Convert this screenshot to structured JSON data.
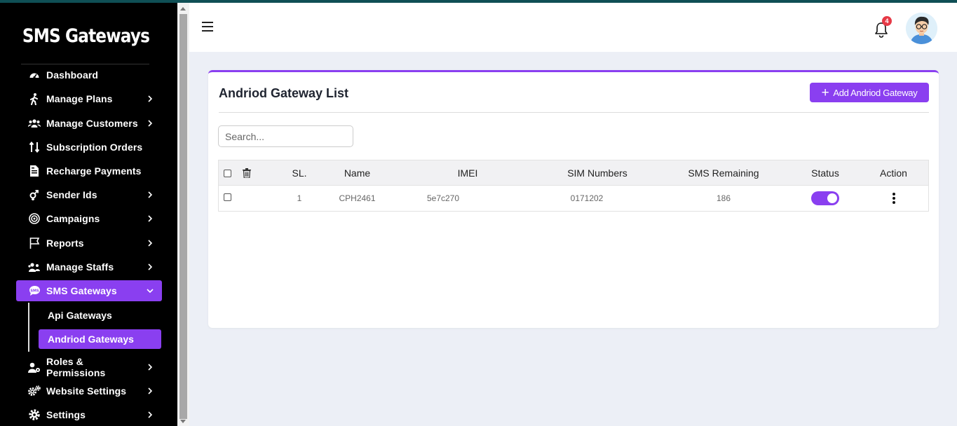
{
  "brand": "SMS Gateways",
  "sidebar": {
    "items": [
      {
        "label": "Dashboard",
        "icon": "gauge-icon"
      },
      {
        "label": "Manage Plans",
        "icon": "walking-icon"
      },
      {
        "label": "Manage Customers",
        "icon": "users-icon"
      },
      {
        "label": "Subscription Orders",
        "icon": "sort-arrows-icon"
      },
      {
        "label": "Recharge Payments",
        "icon": "invoice-icon"
      },
      {
        "label": "Sender Ids",
        "icon": "venus-mars-icon"
      },
      {
        "label": "Campaigns",
        "icon": "target-icon"
      },
      {
        "label": "Reports",
        "icon": "flag-icon"
      },
      {
        "label": "Manage Staffs",
        "icon": "staff-icon"
      },
      {
        "label": "SMS Gateways",
        "icon": "sms-bubble-icon"
      },
      {
        "label": "Roles & Permissions",
        "icon": "user-gear-icon"
      },
      {
        "label": "Website Settings",
        "icon": "gears-icon"
      },
      {
        "label": "Settings",
        "icon": "gear-icon"
      }
    ],
    "submenu": [
      {
        "label": "Api Gateways"
      },
      {
        "label": "Andriod Gateways"
      }
    ]
  },
  "header": {
    "notification_count": "4"
  },
  "main": {
    "title": "Andriod Gateway List",
    "add_button": "Add Andriod Gateway",
    "search_placeholder": "Search...",
    "table": {
      "columns": [
        "SL.",
        "Name",
        "IMEI",
        "SIM Numbers",
        "SMS Remaining",
        "Status",
        "Action"
      ],
      "rows": [
        {
          "sl": "1",
          "name": "CPH2461",
          "imei": "5e7c270",
          "sim": "0171202",
          "sms_remaining": "186",
          "status": true
        }
      ]
    }
  },
  "colors": {
    "accent": "#8a3ff0",
    "sidebar_bg": "#000000",
    "badge": "#e63946"
  }
}
